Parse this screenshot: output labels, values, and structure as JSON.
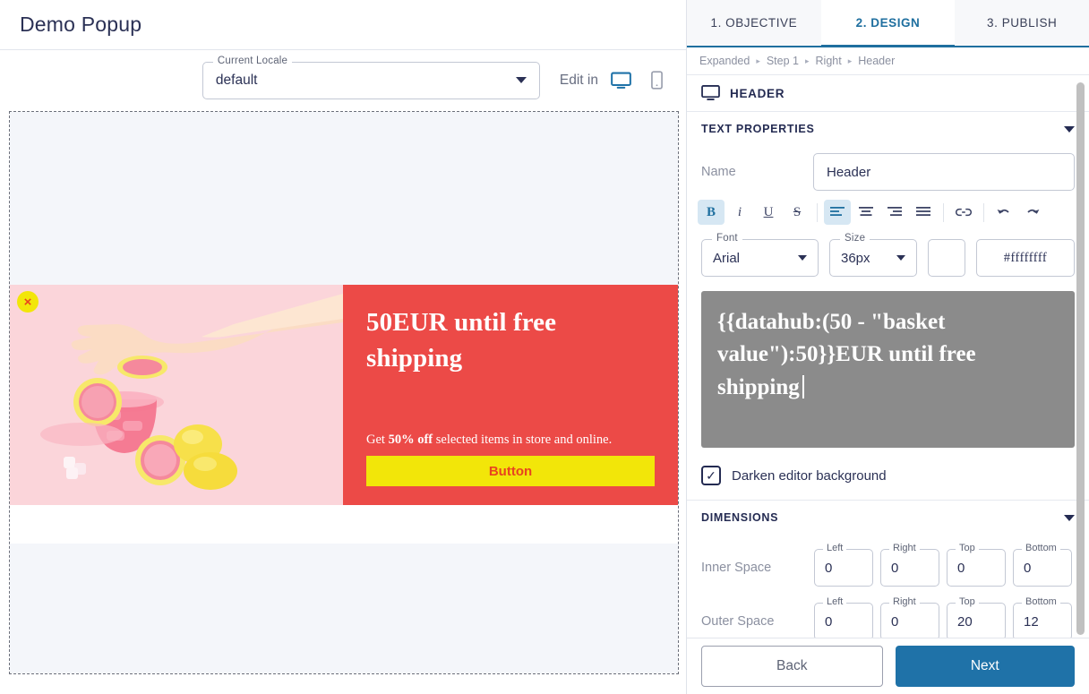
{
  "left": {
    "doc_title": "Demo Popup",
    "locale": {
      "legend": "Current Locale",
      "value": "default"
    },
    "edit_in_label": "Edit in",
    "devices": [
      {
        "name": "desktop-icon",
        "active": true
      },
      {
        "name": "mobile-icon",
        "active": false
      }
    ],
    "popup": {
      "close_label": "×",
      "headline": "50EUR until free shipping",
      "sub_prefix": "Get ",
      "sub_bold": "50% off",
      "sub_suffix": " selected items in store and online.",
      "button_label": "Button",
      "colors": {
        "panel": "#ec4a47",
        "image_bg": "#fbd7dc",
        "button_bg": "#f2e609",
        "button_text": "#e8441f"
      }
    }
  },
  "right": {
    "tabs": [
      {
        "label": "1. OBJECTIVE",
        "active": false
      },
      {
        "label": "2. DESIGN",
        "active": true
      },
      {
        "label": "3. PUBLISH",
        "active": false
      }
    ],
    "breadcrumb": [
      "Expanded",
      "Step 1",
      "Right",
      "Header"
    ],
    "section_header": {
      "icon": "monitor-icon",
      "title": "HEADER"
    },
    "text_properties": {
      "title": "TEXT PROPERTIES",
      "name_label": "Name",
      "name_value": "Header",
      "toolbar": [
        {
          "name": "bold-icon",
          "glyph": "B",
          "active": true
        },
        {
          "name": "italic-icon",
          "glyph": "i",
          "active": false
        },
        {
          "name": "underline-icon",
          "glyph": "U",
          "active": false
        },
        {
          "name": "strikethrough-icon",
          "glyph": "S",
          "active": false
        },
        {
          "name": "align-left-icon",
          "glyph": "",
          "active": true
        },
        {
          "name": "align-center-icon",
          "glyph": "",
          "active": false
        },
        {
          "name": "align-right-icon",
          "glyph": "",
          "active": false
        },
        {
          "name": "align-justify-icon",
          "glyph": "",
          "active": false
        },
        {
          "name": "link-icon",
          "glyph": "",
          "active": false
        },
        {
          "name": "undo-icon",
          "glyph": "",
          "active": false
        },
        {
          "name": "redo-icon",
          "glyph": "",
          "active": false
        }
      ],
      "font": {
        "legend": "Font",
        "value": "Arial"
      },
      "size": {
        "legend": "Size",
        "value": "36px"
      },
      "color_swatch": "#ffffff",
      "color_hex": "#ffffffff",
      "editor_content": "{{datahub:(50 - \"basket value\"):50}}EUR until free shipping",
      "editor_bg": "#8b8b8b",
      "darken_checkbox": {
        "label": "Darken editor background",
        "checked": true,
        "glyph": "✓"
      }
    },
    "dimensions": {
      "title": "DIMENSIONS",
      "rows": [
        {
          "label": "Inner Space",
          "fields": [
            {
              "legend": "Left",
              "value": "0"
            },
            {
              "legend": "Right",
              "value": "0"
            },
            {
              "legend": "Top",
              "value": "0"
            },
            {
              "legend": "Bottom",
              "value": "0"
            }
          ]
        },
        {
          "label": "Outer Space",
          "fields": [
            {
              "legend": "Left",
              "value": "0"
            },
            {
              "legend": "Right",
              "value": "0"
            },
            {
              "legend": "Top",
              "value": "20"
            },
            {
              "legend": "Bottom",
              "value": "12"
            }
          ]
        }
      ]
    },
    "footer": {
      "back_label": "Back",
      "next_label": "Next",
      "next_color": "#1f72a8"
    }
  }
}
